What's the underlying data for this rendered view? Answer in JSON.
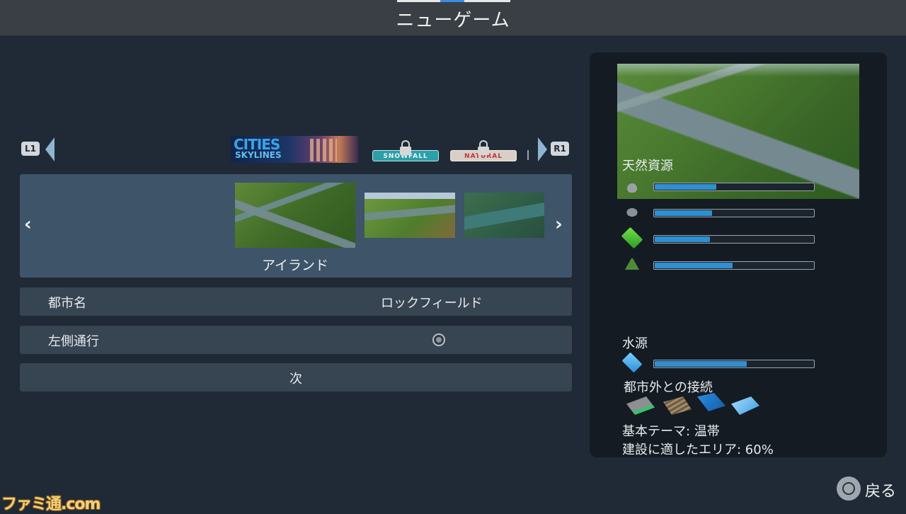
{
  "header": {
    "title": "ニューゲーム"
  },
  "pack_selector": {
    "left_shoulder": "L1",
    "right_shoulder": "R1",
    "packs": [
      {
        "name": "CITIES SKYLINES",
        "line1": "CITIES",
        "line2": "SKYLINES",
        "locked": false
      },
      {
        "name": "SNOWFALL",
        "label": "SNOWFALL",
        "locked": true
      },
      {
        "name": "NATURAL DISASTERS",
        "label": "NATURAL DISASTERS",
        "locked": true
      }
    ]
  },
  "map_carousel": {
    "selected_map": "アイランド",
    "prev_arrow": "‹",
    "next_arrow": "›"
  },
  "options": {
    "city_name_label": "都市名",
    "city_name_value": "ロックフィールド",
    "left_traffic_label": "左側通行",
    "left_traffic_enabled": false,
    "next_label": "次"
  },
  "map_info": {
    "natural_resources_title": "天然資源",
    "resources": [
      {
        "icon": "oil-icon",
        "level": 0.39
      },
      {
        "icon": "ore-icon",
        "level": 0.36
      },
      {
        "icon": "fertile-land-icon",
        "level": 0.35
      },
      {
        "icon": "forest-icon",
        "level": 0.49
      }
    ],
    "water_title": "水源",
    "water": {
      "icon": "water-icon",
      "level": 0.58
    },
    "connections_title": "都市外との接続",
    "connections": [
      "highway-icon",
      "railway-icon",
      "ship-icon",
      "airplane-icon"
    ],
    "theme": "基本テーマ: 温帯",
    "buildable_area": "建設に適したエリア: 60%"
  },
  "footer": {
    "back_label": "戻る",
    "watermark": "ファミ通.com"
  },
  "colors": {
    "accent_bar": "#2f8fd0",
    "background": "#1f2a36",
    "selected_row": "#3e5468"
  }
}
